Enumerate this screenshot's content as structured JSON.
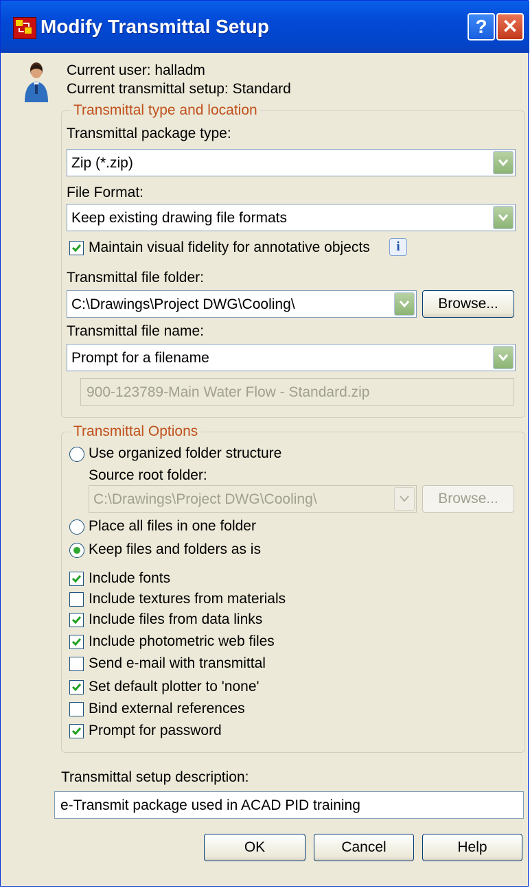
{
  "window": {
    "title": "Modify Transmittal Setup",
    "help_glyph": "?",
    "close_glyph": "✕"
  },
  "header": {
    "current_user": "Current user: halladm",
    "current_setup": "Current transmittal setup: Standard"
  },
  "type_location": {
    "group_title": "Transmittal type and location",
    "package_type_label": "Transmittal package type:",
    "package_type_value": "Zip (*.zip)",
    "file_format_label": "File Format:",
    "file_format_value": "Keep existing drawing file formats",
    "fidelity_label": "Maintain visual fidelity for annotative objects",
    "fidelity_checked": true,
    "info_glyph": "i",
    "folder_label": "Transmittal file folder:",
    "folder_value": "C:\\Drawings\\Project DWG\\Cooling\\",
    "browse_label": "Browse...",
    "filename_label": "Transmittal file name:",
    "filename_value": "Prompt for a filename",
    "filename_preview": "900-123789-Main Water Flow - Standard.zip"
  },
  "options": {
    "group_title": "Transmittal Options",
    "organized_label": "Use organized folder structure",
    "source_root_label": "Source root folder:",
    "source_root_value": "C:\\Drawings\\Project DWG\\Cooling\\",
    "source_browse_label": "Browse...",
    "one_folder_label": "Place all files in one folder",
    "keep_as_is_label": "Keep files and folders as is",
    "selected_radio": "keep_as_is",
    "checkboxes": [
      {
        "label": "Include fonts",
        "checked": true
      },
      {
        "label": "Include textures from materials",
        "checked": false
      },
      {
        "label": "Include files from data links",
        "checked": true
      },
      {
        "label": "Include photometric web files",
        "checked": true
      },
      {
        "label": "Send e-mail with transmittal",
        "checked": false
      },
      {
        "label": "Set default plotter to 'none'",
        "checked": true
      },
      {
        "label": "Bind external references",
        "checked": false
      },
      {
        "label": "Prompt for password",
        "checked": true
      }
    ]
  },
  "description": {
    "label": "Transmittal setup description:",
    "value": "e-Transmit package used in ACAD PID training"
  },
  "buttons": {
    "ok": "OK",
    "cancel": "Cancel",
    "help": "Help"
  },
  "colors": {
    "title_bar": "#0249d6",
    "group_title": "#c0501c",
    "dialog_bg": "#ece9d8",
    "check_green": "#21a121"
  },
  "icons": {
    "app": "autocad-app-icon",
    "user": "user-avatar-icon",
    "info": "info-icon",
    "dropdown": "chevron-down-icon",
    "check": "checkmark-icon"
  }
}
